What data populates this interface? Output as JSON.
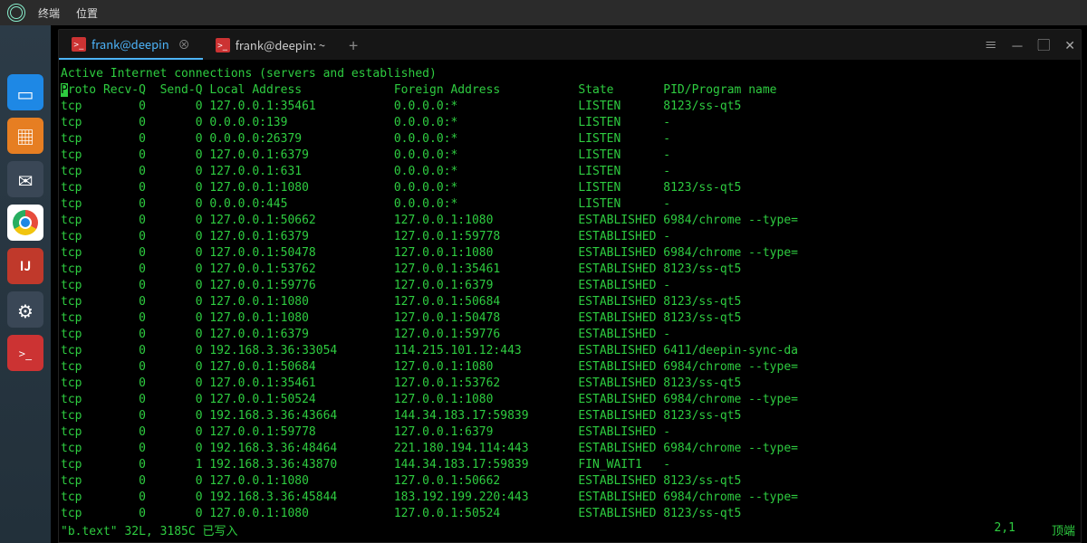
{
  "menubar": {
    "app": "终端",
    "loc": "位置"
  },
  "dock": {
    "chrome_name": "chrome-icon",
    "gear": "⚙",
    "term": ">_"
  },
  "tabs": [
    {
      "label": "frank@deepin",
      "active": true
    },
    {
      "label": "frank@deepin: ~",
      "active": false
    }
  ],
  "wincontrols": {
    "menu": "≡",
    "min": "—",
    "max": "▢",
    "close": "✕"
  },
  "term": {
    "title": "Active Internet connections (servers and established)",
    "headers": [
      "Proto",
      "Recv-Q",
      "Send-Q",
      "Local Address",
      "Foreign Address",
      "State",
      "PID/Program name"
    ],
    "rows": [
      [
        "tcp",
        "0",
        "0",
        "127.0.0.1:35461",
        "0.0.0.0:*",
        "LISTEN",
        "8123/ss-qt5"
      ],
      [
        "tcp",
        "0",
        "0",
        "0.0.0.0:139",
        "0.0.0.0:*",
        "LISTEN",
        "-"
      ],
      [
        "tcp",
        "0",
        "0",
        "0.0.0.0:26379",
        "0.0.0.0:*",
        "LISTEN",
        "-"
      ],
      [
        "tcp",
        "0",
        "0",
        "127.0.0.1:6379",
        "0.0.0.0:*",
        "LISTEN",
        "-"
      ],
      [
        "tcp",
        "0",
        "0",
        "127.0.0.1:631",
        "0.0.0.0:*",
        "LISTEN",
        "-"
      ],
      [
        "tcp",
        "0",
        "0",
        "127.0.0.1:1080",
        "0.0.0.0:*",
        "LISTEN",
        "8123/ss-qt5"
      ],
      [
        "tcp",
        "0",
        "0",
        "0.0.0.0:445",
        "0.0.0.0:*",
        "LISTEN",
        "-"
      ],
      [
        "tcp",
        "0",
        "0",
        "127.0.0.1:50662",
        "127.0.0.1:1080",
        "ESTABLISHED",
        "6984/chrome --type="
      ],
      [
        "tcp",
        "0",
        "0",
        "127.0.0.1:6379",
        "127.0.0.1:59778",
        "ESTABLISHED",
        "-"
      ],
      [
        "tcp",
        "0",
        "0",
        "127.0.0.1:50478",
        "127.0.0.1:1080",
        "ESTABLISHED",
        "6984/chrome --type="
      ],
      [
        "tcp",
        "0",
        "0",
        "127.0.0.1:53762",
        "127.0.0.1:35461",
        "ESTABLISHED",
        "8123/ss-qt5"
      ],
      [
        "tcp",
        "0",
        "0",
        "127.0.0.1:59776",
        "127.0.0.1:6379",
        "ESTABLISHED",
        "-"
      ],
      [
        "tcp",
        "0",
        "0",
        "127.0.0.1:1080",
        "127.0.0.1:50684",
        "ESTABLISHED",
        "8123/ss-qt5"
      ],
      [
        "tcp",
        "0",
        "0",
        "127.0.0.1:1080",
        "127.0.0.1:50478",
        "ESTABLISHED",
        "8123/ss-qt5"
      ],
      [
        "tcp",
        "0",
        "0",
        "127.0.0.1:6379",
        "127.0.0.1:59776",
        "ESTABLISHED",
        "-"
      ],
      [
        "tcp",
        "0",
        "0",
        "192.168.3.36:33054",
        "114.215.101.12:443",
        "ESTABLISHED",
        "6411/deepin-sync-da"
      ],
      [
        "tcp",
        "0",
        "0",
        "127.0.0.1:50684",
        "127.0.0.1:1080",
        "ESTABLISHED",
        "6984/chrome --type="
      ],
      [
        "tcp",
        "0",
        "0",
        "127.0.0.1:35461",
        "127.0.0.1:53762",
        "ESTABLISHED",
        "8123/ss-qt5"
      ],
      [
        "tcp",
        "0",
        "0",
        "127.0.0.1:50524",
        "127.0.0.1:1080",
        "ESTABLISHED",
        "6984/chrome --type="
      ],
      [
        "tcp",
        "0",
        "0",
        "192.168.3.36:43664",
        "144.34.183.17:59839",
        "ESTABLISHED",
        "8123/ss-qt5"
      ],
      [
        "tcp",
        "0",
        "0",
        "127.0.0.1:59778",
        "127.0.0.1:6379",
        "ESTABLISHED",
        "-"
      ],
      [
        "tcp",
        "0",
        "0",
        "192.168.3.36:48464",
        "221.180.194.114:443",
        "ESTABLISHED",
        "6984/chrome --type="
      ],
      [
        "tcp",
        "0",
        "1",
        "192.168.3.36:43870",
        "144.34.183.17:59839",
        "FIN_WAIT1",
        "-"
      ],
      [
        "tcp",
        "0",
        "0",
        "127.0.0.1:1080",
        "127.0.0.1:50662",
        "ESTABLISHED",
        "8123/ss-qt5"
      ],
      [
        "tcp",
        "0",
        "0",
        "192.168.3.36:45844",
        "183.192.199.220:443",
        "ESTABLISHED",
        "6984/chrome --type="
      ],
      [
        "tcp",
        "0",
        "0",
        "127.0.0.1:1080",
        "127.0.0.1:50524",
        "ESTABLISHED",
        "8123/ss-qt5"
      ]
    ],
    "status_left": "\"b.text\" 32L, 3185C 已写入",
    "status_pos": "2,1",
    "status_right": "顶端"
  }
}
